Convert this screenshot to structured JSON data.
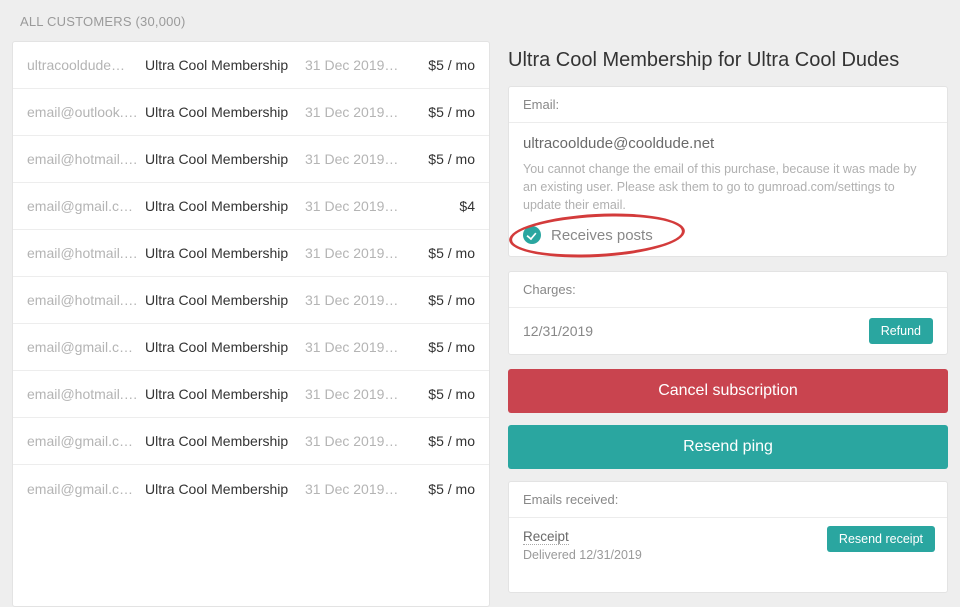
{
  "header": {
    "title": "ALL CUSTOMERS (30,000)"
  },
  "customers": [
    {
      "email": "ultracooldude…",
      "product": "Ultra Cool Membership",
      "date": "31 Dec 2019…",
      "price": "$5 / mo"
    },
    {
      "email": "email@outlook.…",
      "product": "Ultra Cool Membership",
      "date": "31 Dec 2019…",
      "price": "$5 / mo"
    },
    {
      "email": "email@hotmail.…",
      "product": "Ultra Cool Membership",
      "date": "31 Dec 2019…",
      "price": "$5 / mo"
    },
    {
      "email": "email@gmail.c…",
      "product": "Ultra Cool Membership",
      "date": "31 Dec 2019…",
      "price": "$4"
    },
    {
      "email": "email@hotmail.…",
      "product": "Ultra Cool Membership",
      "date": "31 Dec 2019…",
      "price": "$5 / mo"
    },
    {
      "email": "email@hotmail.…",
      "product": "Ultra Cool Membership",
      "date": "31 Dec 2019…",
      "price": "$5 / mo"
    },
    {
      "email": "email@gmail.c…",
      "product": "Ultra Cool Membership",
      "date": "31 Dec 2019…",
      "price": "$5 / mo"
    },
    {
      "email": "email@hotmail.…",
      "product": "Ultra Cool Membership",
      "date": "31 Dec 2019…",
      "price": "$5 / mo"
    },
    {
      "email": "email@gmail.c…",
      "product": "Ultra Cool Membership",
      "date": "31 Dec 2019…",
      "price": "$5 / mo"
    },
    {
      "email": "email@gmail.c…",
      "product": "Ultra Cool Membership",
      "date": "31 Dec 2019…",
      "price": "$5 / mo"
    }
  ],
  "detail": {
    "title": "Ultra Cool Membership for Ultra Cool Dudes",
    "email_label": "Email:",
    "email_value": "ultracooldude@cooldude.net",
    "email_note": "You cannot change the email of this purchase, because it was made by an existing user. Please ask them to go to gumroad.com/settings to update their email.",
    "receives_label": "Receives posts",
    "charges_label": "Charges:",
    "charge_date": "12/31/2019",
    "refund_label": "Refund",
    "cancel_label": "Cancel subscription",
    "resend_ping_label": "Resend ping",
    "emails_received_label": "Emails received:",
    "receipt_label": "Receipt",
    "delivered_label": "Delivered 12/31/2019",
    "resend_receipt_label": "Resend receipt"
  }
}
